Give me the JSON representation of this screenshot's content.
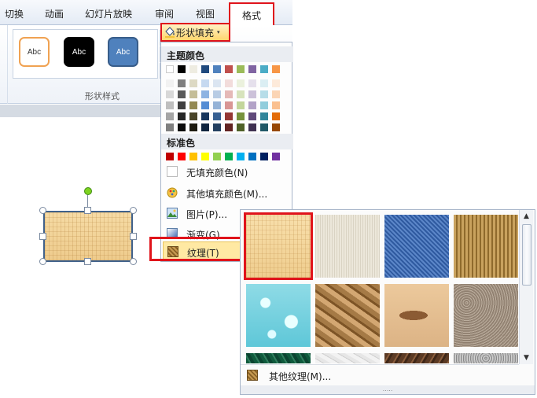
{
  "ribbon": {
    "tabs": [
      "切换",
      "动画",
      "幻灯片放映",
      "审阅",
      "视图"
    ],
    "active_tab": "格式",
    "shape_styles": [
      "Abc",
      "Abc",
      "Abc"
    ],
    "group_label": "形状样式",
    "gallery_arrows": [
      "▲",
      "▼",
      "≡"
    ]
  },
  "fill_button": {
    "label": "形状填充",
    "caret": "▾"
  },
  "fill_menu": {
    "theme_colors_heading": "主题颜色",
    "standard_colors_heading": "标准色",
    "theme_colors_top": [
      "#ffffff",
      "#000000",
      "#eeece1",
      "#1f497d",
      "#4f81bd",
      "#c0504d",
      "#9bbb59",
      "#8064a2",
      "#4bacc6",
      "#f79646"
    ],
    "theme_colors_shades": [
      [
        "#f2f2f2",
        "#7f7f7f",
        "#ddd9c3",
        "#c6d9f0",
        "#dbe5f1",
        "#f2dcdb",
        "#ebf1dd",
        "#e5e0ec",
        "#dbeef3",
        "#fdeada"
      ],
      [
        "#d8d8d8",
        "#595959",
        "#c4bd97",
        "#8db3e2",
        "#b8cce4",
        "#e5b9b7",
        "#d7e3bc",
        "#ccc1d9",
        "#b7dde8",
        "#fbd5b5"
      ],
      [
        "#bfbfbf",
        "#3f3f3f",
        "#938953",
        "#548dd4",
        "#95b3d7",
        "#d99694",
        "#c3d69b",
        "#b2a2c7",
        "#92cddc",
        "#fac08f"
      ],
      [
        "#a5a5a5",
        "#262626",
        "#494429",
        "#17365d",
        "#366092",
        "#953734",
        "#76923c",
        "#5f497a",
        "#31859b",
        "#e36c09"
      ],
      [
        "#7f7f7f",
        "#0c0c0c",
        "#1d1b10",
        "#0f243e",
        "#244061",
        "#632423",
        "#4f6128",
        "#3f3151",
        "#205867",
        "#974806"
      ]
    ],
    "standard_colors": [
      "#c00000",
      "#ff0000",
      "#ffc000",
      "#ffff00",
      "#92d050",
      "#00b050",
      "#00b0f0",
      "#0070c0",
      "#002060",
      "#7030a0"
    ],
    "items": {
      "no_fill": "无填充颜色(N)",
      "more_colors": "其他填充颜色(M)...",
      "picture": "图片(P)...",
      "gradient": "渐变(G)",
      "texture": "纹理(T)"
    },
    "submenu_arrow": "▸"
  },
  "texture_gallery": {
    "textures": [
      "papyrus",
      "canvas",
      "denim",
      "woven-mat",
      "water-droplets",
      "paper-bag",
      "fish-fossil",
      "sand",
      "green-marble",
      "white-marble",
      "brown-marble",
      "granite"
    ],
    "more_textures": "其他纹理(M)...",
    "scroll_up": "▲",
    "scroll_down": "▼",
    "grip": "....."
  }
}
